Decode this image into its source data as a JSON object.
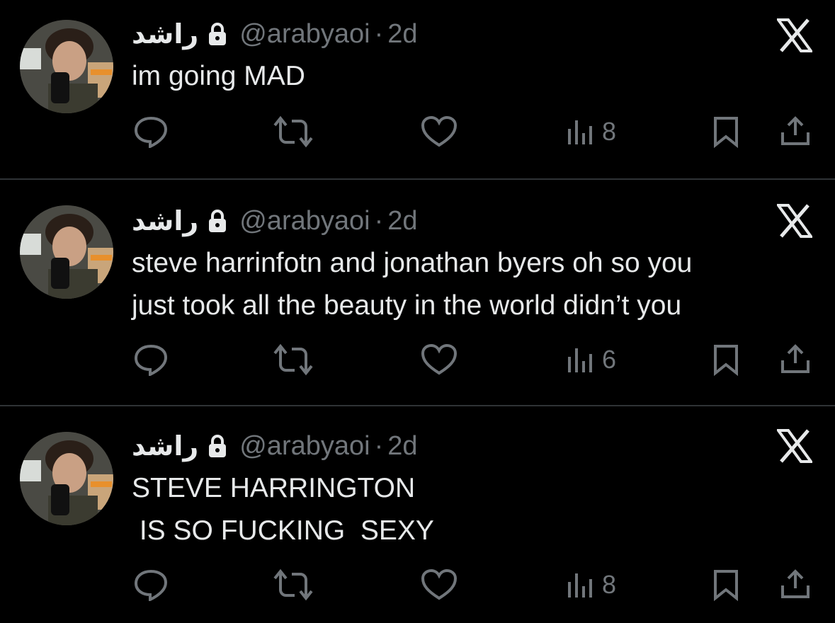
{
  "tweets": [
    {
      "display_name": "راشد",
      "handle": "@arabyaoi",
      "separator": "·",
      "time": "2d",
      "text": "im going MAD",
      "views": "8",
      "locked": true
    },
    {
      "display_name": "راشد",
      "handle": "@arabyaoi",
      "separator": "·",
      "time": "2d",
      "text": "steve harrinfotn and jonathan byers oh so you\njust took all the beauty in the world didn’t you",
      "views": "6",
      "locked": true
    },
    {
      "display_name": "راشد",
      "handle": "@arabyaoi",
      "separator": "·",
      "time": "2d",
      "text": "STEVE HARRINGTON\n IS SO FUCKING  SEXY",
      "views": "8",
      "locked": true
    }
  ],
  "colors": {
    "background": "#000000",
    "primary_text": "#e7e9ea",
    "secondary_text": "#71767b",
    "divider": "#2f3336"
  },
  "icons": [
    "x-logo-icon",
    "lock-icon",
    "reply-icon",
    "retweet-icon",
    "like-icon",
    "views-icon",
    "bookmark-icon",
    "share-icon"
  ]
}
